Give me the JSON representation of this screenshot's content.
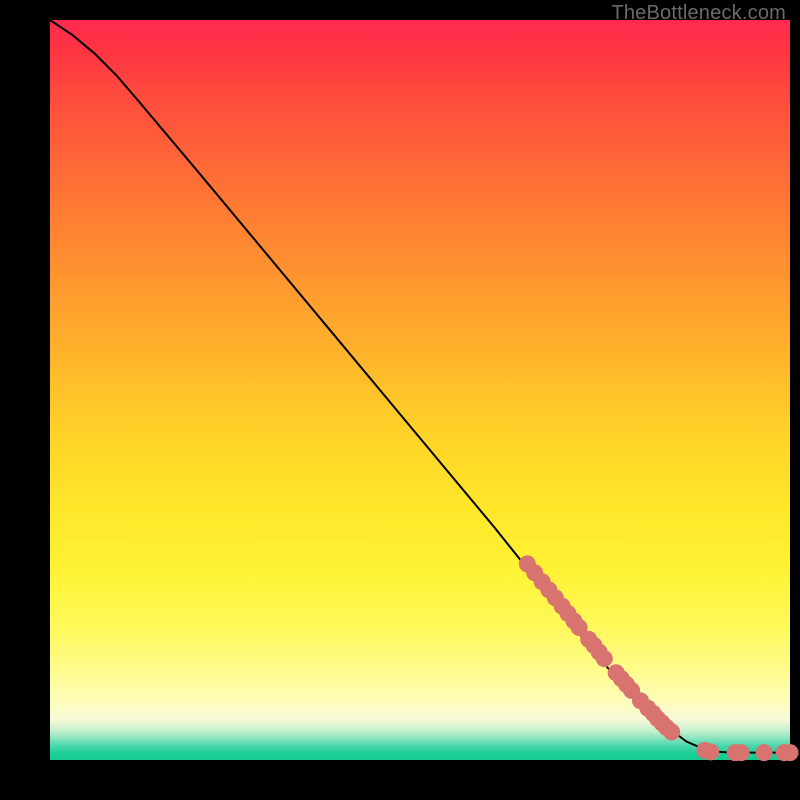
{
  "attribution": "TheBottleneck.com",
  "chart_data": {
    "type": "line",
    "title": "",
    "xlabel": "",
    "ylabel": "",
    "xlim": [
      0,
      100
    ],
    "ylim": [
      0,
      100
    ],
    "curve": [
      {
        "x": 0,
        "y": 100
      },
      {
        "x": 3,
        "y": 98
      },
      {
        "x": 6,
        "y": 95.5
      },
      {
        "x": 9,
        "y": 92.5
      },
      {
        "x": 12,
        "y": 89
      },
      {
        "x": 20,
        "y": 79.5
      },
      {
        "x": 30,
        "y": 67.5
      },
      {
        "x": 40,
        "y": 55.5
      },
      {
        "x": 50,
        "y": 43.5
      },
      {
        "x": 60,
        "y": 31.5
      },
      {
        "x": 66,
        "y": 24
      },
      {
        "x": 70,
        "y": 19
      },
      {
        "x": 74,
        "y": 14
      },
      {
        "x": 78,
        "y": 9.5
      },
      {
        "x": 82,
        "y": 5.5
      },
      {
        "x": 86,
        "y": 2.5
      },
      {
        "x": 89,
        "y": 1.2
      },
      {
        "x": 92,
        "y": 1.0
      },
      {
        "x": 96,
        "y": 1.0
      },
      {
        "x": 100,
        "y": 1.0
      }
    ],
    "series": [
      {
        "name": "highlighted-points",
        "color": "#d8736f",
        "points": [
          {
            "x": 64.5,
            "y": 26.5
          },
          {
            "x": 65.5,
            "y": 25.3
          },
          {
            "x": 66.5,
            "y": 24.1
          },
          {
            "x": 67.4,
            "y": 23.0
          },
          {
            "x": 68.3,
            "y": 21.9
          },
          {
            "x": 69.2,
            "y": 20.8
          },
          {
            "x": 70.0,
            "y": 19.8
          },
          {
            "x": 70.8,
            "y": 18.8
          },
          {
            "x": 71.5,
            "y": 17.9
          },
          {
            "x": 72.8,
            "y": 16.3
          },
          {
            "x": 73.5,
            "y": 15.5
          },
          {
            "x": 74.2,
            "y": 14.6
          },
          {
            "x": 74.9,
            "y": 13.7
          },
          {
            "x": 76.5,
            "y": 11.8
          },
          {
            "x": 77.2,
            "y": 11.0
          },
          {
            "x": 77.9,
            "y": 10.2
          },
          {
            "x": 78.6,
            "y": 9.4
          },
          {
            "x": 79.8,
            "y": 8.0
          },
          {
            "x": 80.8,
            "y": 7.0
          },
          {
            "x": 81.5,
            "y": 6.3
          },
          {
            "x": 82.1,
            "y": 5.6
          },
          {
            "x": 82.7,
            "y": 5.0
          },
          {
            "x": 83.3,
            "y": 4.4
          },
          {
            "x": 84.0,
            "y": 3.8
          },
          {
            "x": 88.5,
            "y": 1.3
          },
          {
            "x": 89.3,
            "y": 1.1
          },
          {
            "x": 92.6,
            "y": 1.0
          },
          {
            "x": 93.4,
            "y": 1.0
          },
          {
            "x": 96.5,
            "y": 1.0
          },
          {
            "x": 99.2,
            "y": 1.0
          },
          {
            "x": 100.0,
            "y": 1.0
          }
        ]
      }
    ],
    "colors": {
      "curve": "#000000",
      "points": "#d8736f",
      "background_top": "#ff2a4f",
      "background_mid": "#ffe72a",
      "background_bottom": "#14cb8e"
    }
  }
}
